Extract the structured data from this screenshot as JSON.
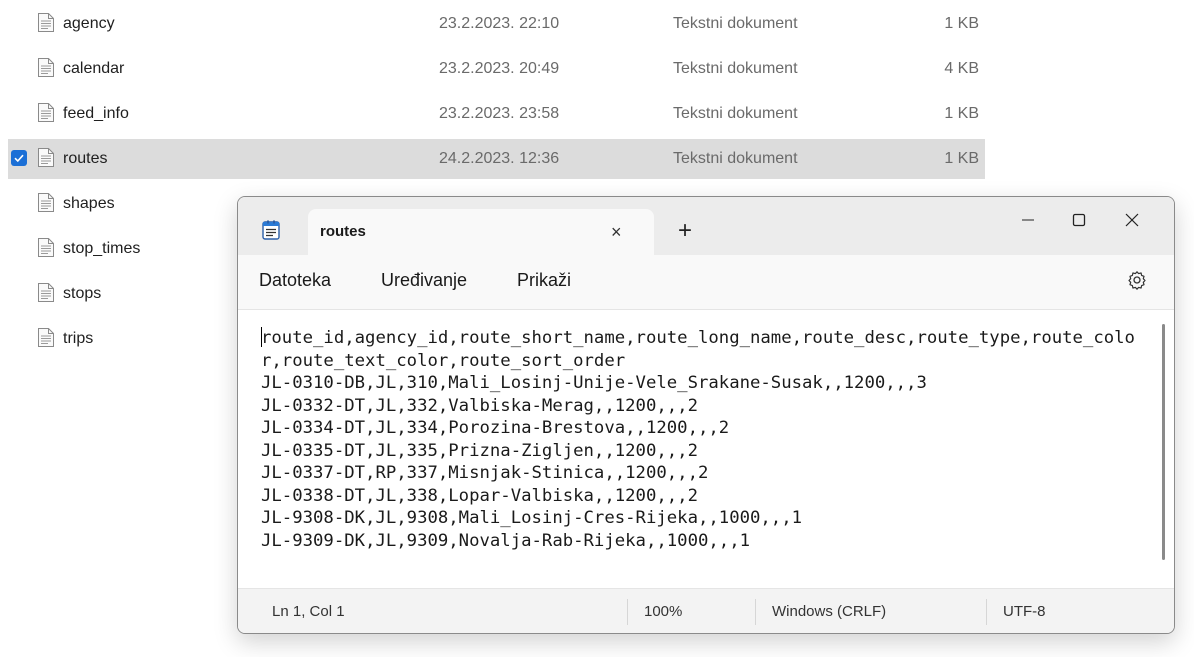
{
  "explorer": {
    "files": [
      {
        "name": "agency",
        "date": "23.2.2023. 22:10",
        "type": "Tekstni dokument",
        "size": "1 KB",
        "selected": false
      },
      {
        "name": "calendar",
        "date": "23.2.2023. 20:49",
        "type": "Tekstni dokument",
        "size": "4 KB",
        "selected": false
      },
      {
        "name": "feed_info",
        "date": "23.2.2023. 23:58",
        "type": "Tekstni dokument",
        "size": "1 KB",
        "selected": false
      },
      {
        "name": "routes",
        "date": "24.2.2023. 12:36",
        "type": "Tekstni dokument",
        "size": "1 KB",
        "selected": true
      },
      {
        "name": "shapes",
        "date": "",
        "type": "",
        "size": "",
        "selected": false
      },
      {
        "name": "stop_times",
        "date": "",
        "type": "",
        "size": "",
        "selected": false
      },
      {
        "name": "stops",
        "date": "",
        "type": "",
        "size": "",
        "selected": false
      },
      {
        "name": "trips",
        "date": "",
        "type": "",
        "size": "",
        "selected": false
      }
    ]
  },
  "notepad": {
    "tab_title": "routes",
    "new_tab_glyph": "+",
    "close_tab_glyph": "×",
    "menu": {
      "file": "Datoteka",
      "edit": "Uređivanje",
      "view": "Prikaži"
    },
    "content": "route_id,agency_id,route_short_name,route_long_name,route_desc,route_type,route_color,route_text_color,route_sort_order\nJL-0310-DB,JL,310,Mali_Losinj-Unije-Vele_Srakane-Susak,,1200,,,3\nJL-0332-DT,JL,332,Valbiska-Merag,,1200,,,2\nJL-0334-DT,JL,334,Porozina-Brestova,,1200,,,2\nJL-0335-DT,JL,335,Prizna-Zigljen,,1200,,,2\nJL-0337-DT,RP,337,Misnjak-Stinica,,1200,,,2\nJL-0338-DT,JL,338,Lopar-Valbiska,,1200,,,2\nJL-9308-DK,JL,9308,Mali_Losinj-Cres-Rijeka,,1000,,,1\nJL-9309-DK,JL,9309,Novalja-Rab-Rijeka,,1000,,,1",
    "status": {
      "position": "Ln 1, Col 1",
      "zoom": "100%",
      "line_ending": "Windows (CRLF)",
      "encoding": "UTF-8"
    }
  },
  "colors": {
    "accent": "#1b6fd6",
    "selection": "#dcdcdc"
  }
}
